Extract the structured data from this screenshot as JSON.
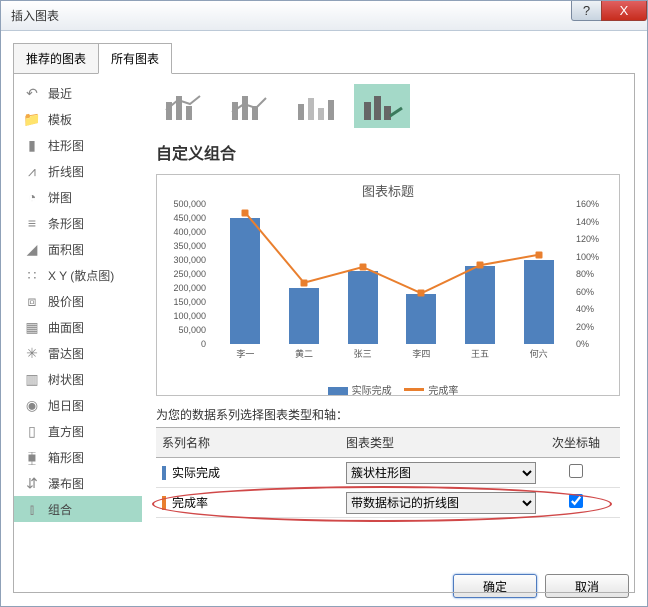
{
  "window": {
    "title": "插入图表",
    "help": "?",
    "close": "X"
  },
  "tabs": {
    "recommended": "推荐的图表",
    "all": "所有图表"
  },
  "sidebar": {
    "items": [
      {
        "label": "最近",
        "ico": "↶"
      },
      {
        "label": "模板",
        "ico": "📁"
      },
      {
        "label": "柱形图",
        "ico": "▮"
      },
      {
        "label": "折线图",
        "ico": "⩘"
      },
      {
        "label": "饼图",
        "ico": "◔"
      },
      {
        "label": "条形图",
        "ico": "≡"
      },
      {
        "label": "面积图",
        "ico": "◢"
      },
      {
        "label": "X Y (散点图)",
        "ico": "∷"
      },
      {
        "label": "股价图",
        "ico": "⧈"
      },
      {
        "label": "曲面图",
        "ico": "▦"
      },
      {
        "label": "雷达图",
        "ico": "✳"
      },
      {
        "label": "树状图",
        "ico": "▥"
      },
      {
        "label": "旭日图",
        "ico": "◉"
      },
      {
        "label": "直方图",
        "ico": "▯"
      },
      {
        "label": "箱形图",
        "ico": "⧯"
      },
      {
        "label": "瀑布图",
        "ico": "⇵"
      },
      {
        "label": "组合",
        "ico": "⫾"
      }
    ]
  },
  "main": {
    "section_title": "自定义组合",
    "preview_title": "图表标题",
    "series_prompt": "为您的数据系列选择图表类型和轴：",
    "headers": {
      "name": "系列名称",
      "type": "图表类型",
      "axis": "次坐标轴"
    },
    "rows": [
      {
        "marker": "#4f81bd",
        "name": "实际完成",
        "type": "簇状柱形图",
        "checked": false
      },
      {
        "marker": "#e97f2e",
        "name": "完成率",
        "type": "带数据标记的折线图",
        "checked": true
      }
    ],
    "legend": {
      "s1": "实际完成",
      "s2": "完成率"
    }
  },
  "footer": {
    "ok": "确定",
    "cancel": "取消"
  },
  "chart_data": {
    "type": "combo",
    "title": "图表标题",
    "categories": [
      "李一",
      "黄二",
      "张三",
      "李四",
      "王五",
      "何六"
    ],
    "series": [
      {
        "name": "实际完成",
        "type": "bar",
        "axis": "primary",
        "values": [
          450000,
          200000,
          260000,
          180000,
          280000,
          300000
        ]
      },
      {
        "name": "完成率",
        "type": "line",
        "axis": "secondary",
        "values": [
          1.5,
          0.7,
          0.88,
          0.58,
          0.9,
          1.02
        ]
      }
    ],
    "y_primary": {
      "min": 0,
      "max": 500000,
      "step": 50000,
      "ticks": [
        "0",
        "50,000",
        "100,000",
        "150,000",
        "200,000",
        "250,000",
        "300,000",
        "350,000",
        "400,000",
        "450,000",
        "500,000"
      ]
    },
    "y_secondary": {
      "min": 0,
      "max": 1.6,
      "step": 0.2,
      "ticks": [
        "0%",
        "20%",
        "40%",
        "60%",
        "80%",
        "100%",
        "120%",
        "140%",
        "160%"
      ]
    }
  }
}
